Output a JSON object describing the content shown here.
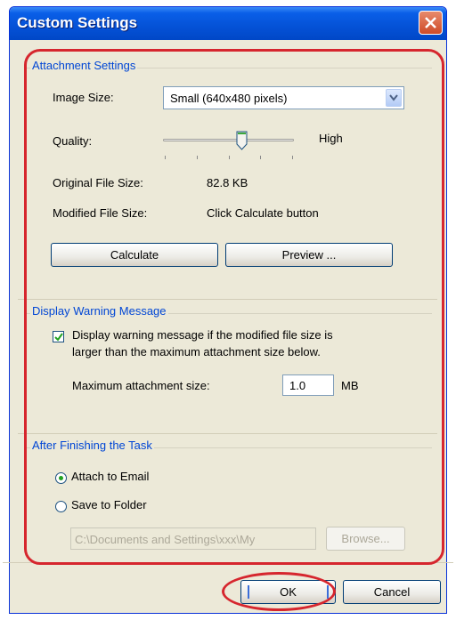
{
  "window": {
    "title": "Custom Settings",
    "close_icon": "close-icon"
  },
  "attachment": {
    "legend": "Attachment Settings",
    "image_size_label": "Image Size:",
    "image_size_value": "Small (640x480 pixels)",
    "quality_label": "Quality:",
    "quality_high": "High",
    "quality_level": 0.6,
    "original_label": "Original File Size:",
    "original_value": "82.8 KB",
    "modified_label": "Modified File Size:",
    "modified_value": "Click Calculate button",
    "calculate": "Calculate",
    "preview": "Preview ..."
  },
  "warning": {
    "legend": "Display Warning Message",
    "checkbox_checked": true,
    "checkbox_line1": "Display warning message if the modified file size is",
    "checkbox_line2": "larger than the maximum attachment size below.",
    "max_label": "Maximum attachment size:",
    "max_value": "1.0",
    "unit": "MB"
  },
  "after": {
    "legend": "After Finishing the Task",
    "option_email": "Attach to Email",
    "option_folder": "Save to Folder",
    "selected": "email",
    "folder_path": "C:\\Documents and Settings\\xxx\\My",
    "browse": "Browse..."
  },
  "footer": {
    "ok": "OK",
    "cancel": "Cancel"
  },
  "colors": {
    "highlight": "#d6262e",
    "titlebar": "#0553d8",
    "group_legend": "#0046d5"
  }
}
